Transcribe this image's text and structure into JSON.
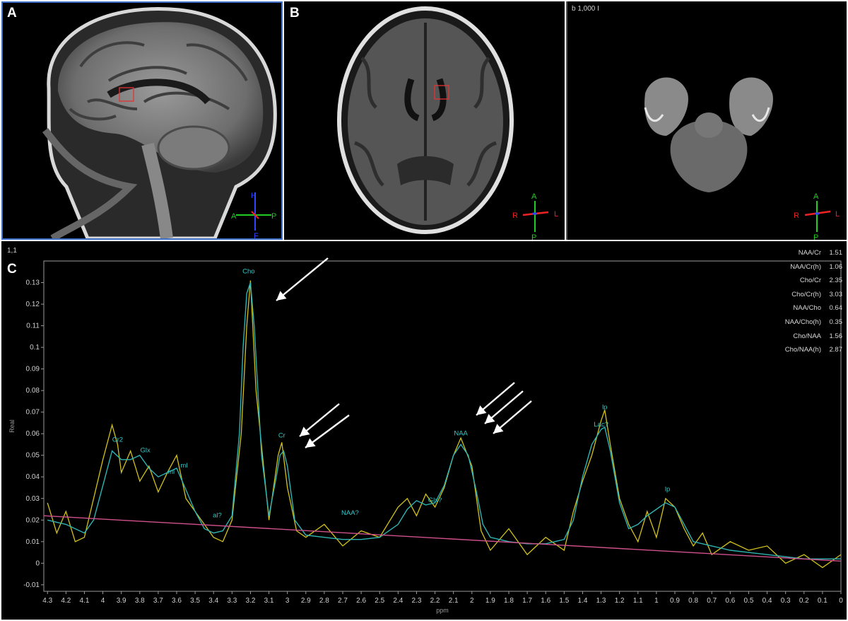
{
  "panels": {
    "a": {
      "label": "A"
    },
    "b": {
      "label": "B",
      "orientation": {
        "top": "A",
        "bottom": "P",
        "left": "R",
        "right": "L"
      }
    },
    "c_dwi": {
      "header": "b 1,000 I",
      "orientation": {
        "top": "A",
        "bottom": "P",
        "left": "R",
        "right": "L"
      }
    },
    "a_orientation": {
      "top": "H",
      "bottom": "F",
      "left": "A",
      "right": "P"
    },
    "c": {
      "label": "C",
      "index": "1,1"
    }
  },
  "ratios": [
    {
      "name": "NAA/Cr",
      "value": "1.51"
    },
    {
      "name": "NAA/Cr(h)",
      "value": "1.06"
    },
    {
      "name": "Cho/Cr",
      "value": "2.35"
    },
    {
      "name": "Cho/Cr(h)",
      "value": "3.03"
    },
    {
      "name": "NAA/Cho",
      "value": "0.64"
    },
    {
      "name": "NAA/Cho(h)",
      "value": "0.35"
    },
    {
      "name": "Cho/NAA",
      "value": "1.56"
    },
    {
      "name": "Cho/NAA(h)",
      "value": "2.87"
    }
  ],
  "chart_data": {
    "type": "line",
    "xlabel": "ppm",
    "ylabel": "Real",
    "x_reversed": true,
    "xlim": [
      4.32,
      0.0
    ],
    "ylim": [
      -0.013,
      0.14
    ],
    "x_ticks": [
      "4.3",
      "4.2",
      "4.1",
      "4",
      "3.9",
      "3.8",
      "3.7",
      "3.6",
      "3.5",
      "3.4",
      "3.3",
      "3.2",
      "3.1",
      "3",
      "2.9",
      "2.8",
      "2.7",
      "2.6",
      "2.5",
      "2.4",
      "2.3",
      "2.2",
      "2.1",
      "2",
      "1.9",
      "1.8",
      "1.7",
      "1.6",
      "1.5",
      "1.4",
      "1.3",
      "1.2",
      "1.1",
      "1",
      "0.9",
      "0.8",
      "0.7",
      "0.6",
      "0.5",
      "0.4",
      "0.3",
      "0.2",
      "0.1",
      "0"
    ],
    "y_ticks": [
      "-0.01",
      "0",
      "0.01",
      "0.02",
      "0.03",
      "0.04",
      "0.05",
      "0.06",
      "0.07",
      "0.08",
      "0.09",
      "0.1",
      "0.11",
      "0.12",
      "0.13"
    ],
    "series": [
      {
        "color": "#d4c21a",
        "x": [
          4.3,
          4.25,
          4.2,
          4.15,
          4.1,
          4.05,
          4.0,
          3.95,
          3.92,
          3.9,
          3.85,
          3.8,
          3.75,
          3.7,
          3.65,
          3.6,
          3.55,
          3.5,
          3.45,
          3.4,
          3.35,
          3.3,
          3.25,
          3.22,
          3.2,
          3.17,
          3.1,
          3.05,
          3.03,
          3.0,
          2.95,
          2.9,
          2.8,
          2.7,
          2.6,
          2.5,
          2.4,
          2.35,
          2.3,
          2.25,
          2.2,
          2.15,
          2.1,
          2.06,
          2.0,
          1.95,
          1.9,
          1.8,
          1.7,
          1.6,
          1.5,
          1.45,
          1.4,
          1.35,
          1.3,
          1.28,
          1.25,
          1.2,
          1.15,
          1.1,
          1.05,
          1.0,
          0.95,
          0.9,
          0.85,
          0.8,
          0.75,
          0.7,
          0.6,
          0.5,
          0.4,
          0.3,
          0.2,
          0.1,
          0.0
        ],
        "y": [
          0.028,
          0.014,
          0.024,
          0.01,
          0.012,
          0.03,
          0.048,
          0.064,
          0.055,
          0.042,
          0.052,
          0.038,
          0.045,
          0.033,
          0.042,
          0.05,
          0.03,
          0.024,
          0.018,
          0.012,
          0.01,
          0.02,
          0.06,
          0.11,
          0.131,
          0.08,
          0.02,
          0.05,
          0.056,
          0.035,
          0.015,
          0.012,
          0.018,
          0.008,
          0.015,
          0.012,
          0.026,
          0.03,
          0.022,
          0.032,
          0.026,
          0.035,
          0.05,
          0.058,
          0.045,
          0.015,
          0.006,
          0.016,
          0.004,
          0.012,
          0.006,
          0.024,
          0.038,
          0.05,
          0.066,
          0.071,
          0.055,
          0.03,
          0.018,
          0.01,
          0.024,
          0.012,
          0.03,
          0.026,
          0.016,
          0.008,
          0.014,
          0.004,
          0.01,
          0.006,
          0.008,
          0.0,
          0.004,
          -0.002,
          0.004
        ]
      },
      {
        "color": "#2fb3b3",
        "x": [
          4.3,
          4.2,
          4.1,
          4.05,
          4.0,
          3.95,
          3.9,
          3.85,
          3.8,
          3.75,
          3.7,
          3.65,
          3.6,
          3.55,
          3.5,
          3.45,
          3.4,
          3.35,
          3.3,
          3.26,
          3.24,
          3.22,
          3.2,
          3.18,
          3.14,
          3.1,
          3.06,
          3.04,
          3.02,
          3.0,
          2.96,
          2.9,
          2.8,
          2.7,
          2.6,
          2.5,
          2.4,
          2.35,
          2.3,
          2.25,
          2.2,
          2.15,
          2.1,
          2.06,
          2.02,
          1.98,
          1.94,
          1.9,
          1.8,
          1.7,
          1.6,
          1.5,
          1.45,
          1.4,
          1.35,
          1.3,
          1.28,
          1.25,
          1.2,
          1.15,
          1.1,
          1.05,
          1.0,
          0.95,
          0.9,
          0.85,
          0.8,
          0.7,
          0.6,
          0.5,
          0.4,
          0.3,
          0.2,
          0.1,
          0.0
        ],
        "y": [
          0.02,
          0.018,
          0.014,
          0.02,
          0.036,
          0.052,
          0.048,
          0.048,
          0.05,
          0.044,
          0.04,
          0.042,
          0.044,
          0.034,
          0.024,
          0.016,
          0.014,
          0.015,
          0.022,
          0.06,
          0.1,
          0.125,
          0.13,
          0.11,
          0.05,
          0.022,
          0.04,
          0.05,
          0.052,
          0.045,
          0.02,
          0.013,
          0.012,
          0.011,
          0.011,
          0.012,
          0.018,
          0.025,
          0.029,
          0.027,
          0.028,
          0.036,
          0.05,
          0.055,
          0.05,
          0.035,
          0.018,
          0.012,
          0.01,
          0.009,
          0.009,
          0.011,
          0.02,
          0.04,
          0.055,
          0.062,
          0.063,
          0.052,
          0.028,
          0.016,
          0.018,
          0.022,
          0.025,
          0.028,
          0.026,
          0.018,
          0.01,
          0.008,
          0.006,
          0.005,
          0.004,
          0.003,
          0.002,
          0.002,
          0.002
        ]
      },
      {
        "color": "#d0508c",
        "x": [
          4.32,
          0.0
        ],
        "y": [
          0.022,
          0.001
        ]
      }
    ],
    "peak_labels": [
      {
        "text": "Cr2",
        "x": 3.92,
        "y": 0.055
      },
      {
        "text": "Glx",
        "x": 3.77,
        "y": 0.05
      },
      {
        "text": "ml",
        "x": 3.63,
        "y": 0.04
      },
      {
        "text": "ml",
        "x": 3.56,
        "y": 0.043
      },
      {
        "text": "al?",
        "x": 3.38,
        "y": 0.02
      },
      {
        "text": "Cho",
        "x": 3.21,
        "y": 0.133
      },
      {
        "text": "Cr",
        "x": 3.03,
        "y": 0.057
      },
      {
        "text": "NAA?",
        "x": 2.66,
        "y": 0.021
      },
      {
        "text": "Glx?",
        "x": 2.2,
        "y": 0.027
      },
      {
        "text": "NAA",
        "x": 2.06,
        "y": 0.058
      },
      {
        "text": "Lac?",
        "x": 1.3,
        "y": 0.062
      },
      {
        "text": "lp",
        "x": 1.28,
        "y": 0.07
      },
      {
        "text": "lp",
        "x": 0.94,
        "y": 0.032
      }
    ]
  }
}
